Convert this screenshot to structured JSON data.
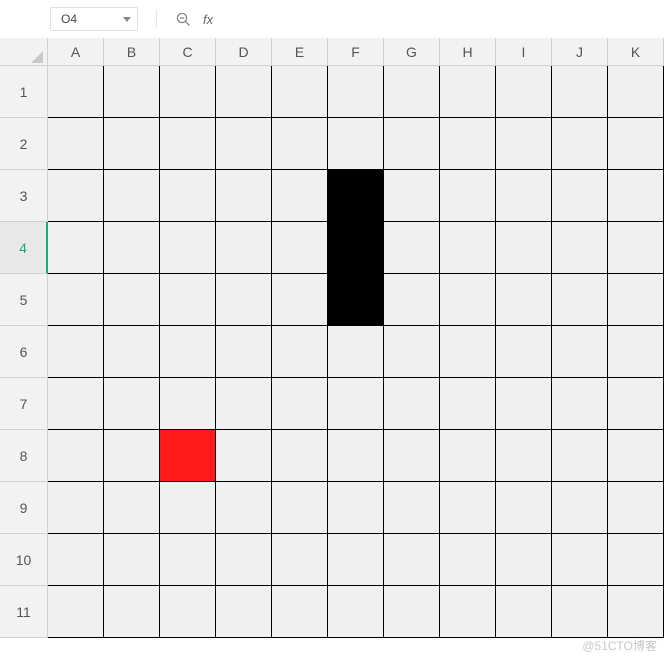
{
  "toolbar": {
    "name_box_value": "O4",
    "fx_label": "fx",
    "formula_value": ""
  },
  "columns": [
    "A",
    "B",
    "C",
    "D",
    "E",
    "F",
    "G",
    "H",
    "I",
    "J",
    "K"
  ],
  "rows": [
    "1",
    "2",
    "3",
    "4",
    "5",
    "6",
    "7",
    "8",
    "9",
    "10",
    "11"
  ],
  "active_row": "4",
  "filled_cells": [
    {
      "col": "F",
      "row": "3",
      "color": "black"
    },
    {
      "col": "F",
      "row": "4",
      "color": "black"
    },
    {
      "col": "F",
      "row": "5",
      "color": "black"
    },
    {
      "col": "C",
      "row": "8",
      "color": "red"
    }
  ],
  "colors": {
    "header_bg": "#f2f2f2",
    "cell_bg": "#f0f0f0",
    "grid_line": "#000000",
    "accent": "#1aac74",
    "fill_black": "#000000",
    "fill_red": "#ff1a1a"
  },
  "watermark": "@51CTO博客"
}
